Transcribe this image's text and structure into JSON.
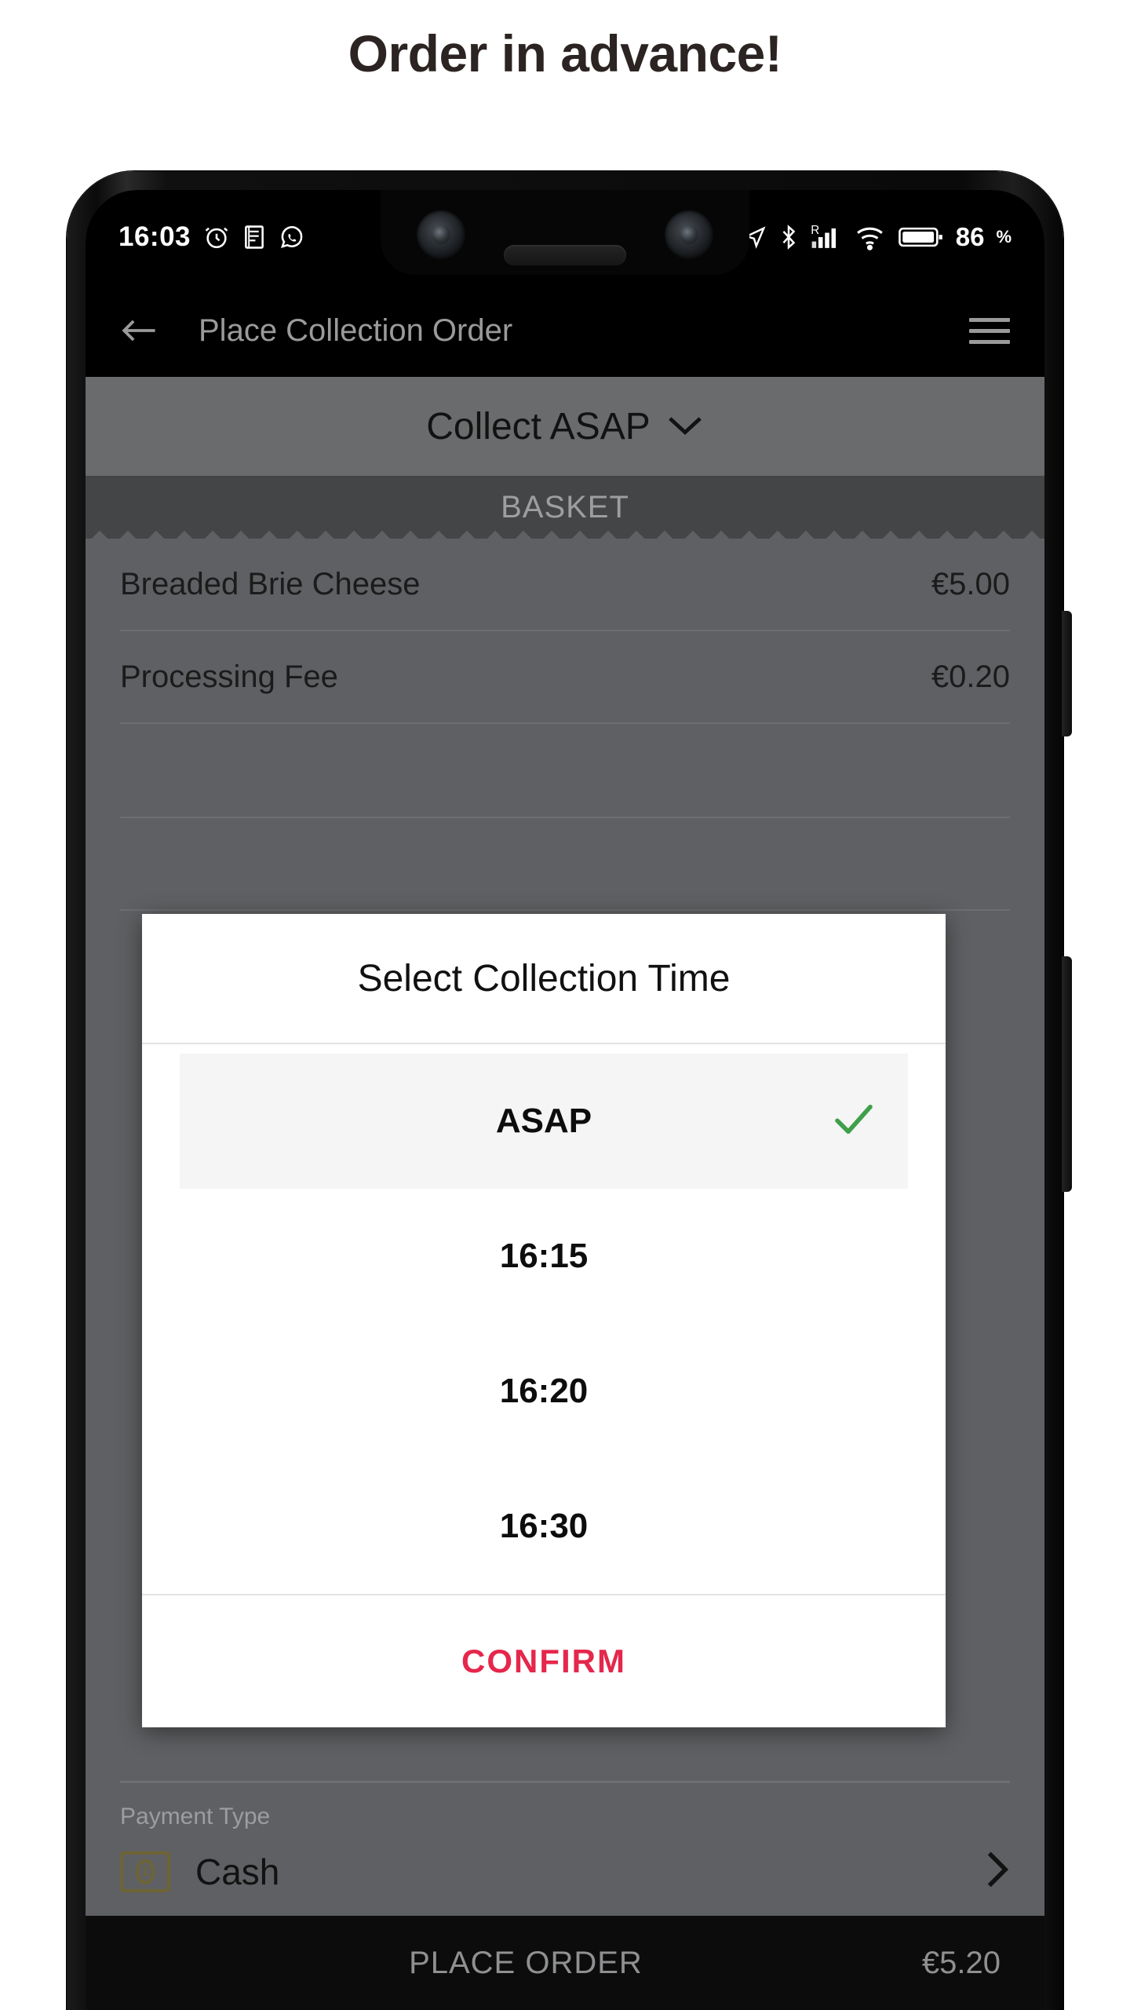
{
  "headline": "Order in advance!",
  "status_bar": {
    "time": "16:03",
    "battery_level": "86",
    "battery_unit": "%",
    "left_icons": [
      "alarm-clock-icon",
      "notes-icon",
      "whatsapp-icon"
    ],
    "right_icons": [
      "location-arrow-icon",
      "bluetooth-icon",
      "roaming-signal-icon",
      "wifi-icon",
      "battery-icon"
    ]
  },
  "app_bar": {
    "back_icon": "back-arrow-icon",
    "title": "Place Collection Order",
    "menu_icon": "hamburger-menu-icon"
  },
  "collect_bar": {
    "label": "Collect ASAP",
    "chevron": "chevron-down-icon"
  },
  "basket": {
    "section_label": "BASKET",
    "items": [
      {
        "name": "Breaded Brie Cheese",
        "price": "€5.00"
      },
      {
        "name": "Processing Fee",
        "price": "€0.20"
      }
    ]
  },
  "payment": {
    "label": "Payment Type",
    "icon": "cash-banknote-icon",
    "icon_color": "#6e6434",
    "value": "Cash",
    "chevron": "chevron-right-icon"
  },
  "bottom_bar": {
    "label": "PLACE ORDER",
    "total": "€5.20"
  },
  "dialog": {
    "title": "Select Collection Time",
    "options": [
      {
        "label": "ASAP",
        "selected": true
      },
      {
        "label": "16:15",
        "selected": false
      },
      {
        "label": "16:20",
        "selected": false
      },
      {
        "label": "16:30",
        "selected": false
      }
    ],
    "check_icon": "check-icon",
    "check_color": "#3ea04a",
    "confirm_label": "CONFIRM",
    "confirm_color": "#e5274c"
  }
}
